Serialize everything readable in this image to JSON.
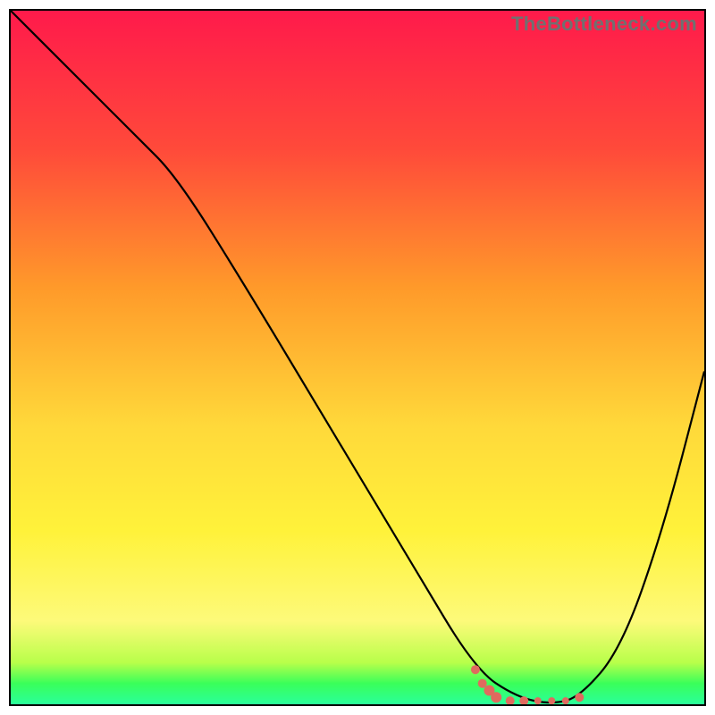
{
  "watermark": "TheBottleneck.com",
  "chart_data": {
    "type": "line",
    "title": "",
    "xlabel": "",
    "ylabel": "",
    "xlim": [
      0,
      100
    ],
    "ylim": [
      0,
      100
    ],
    "gradient_stops": [
      {
        "offset": 0,
        "color": "#ff1a4b"
      },
      {
        "offset": 20,
        "color": "#ff4a3a"
      },
      {
        "offset": 40,
        "color": "#ff9a2a"
      },
      {
        "offset": 60,
        "color": "#ffd93a"
      },
      {
        "offset": 75,
        "color": "#fff23a"
      },
      {
        "offset": 88,
        "color": "#fdfa7a"
      },
      {
        "offset": 94,
        "color": "#b8ff4a"
      },
      {
        "offset": 97,
        "color": "#3aff5a"
      },
      {
        "offset": 100,
        "color": "#2aff9a"
      }
    ],
    "series": [
      {
        "name": "bottleneck-curve",
        "color": "#000000",
        "x": [
          0,
          8,
          18,
          24,
          34,
          46,
          58,
          67,
          73,
          78,
          82,
          88,
          94,
          100
        ],
        "y": [
          100,
          92,
          82,
          76,
          60,
          40,
          20,
          5,
          1,
          0,
          1,
          8,
          25,
          48
        ]
      }
    ],
    "markers": {
      "name": "optimal-range",
      "color": "#e06a5e",
      "points": [
        {
          "x": 67,
          "y": 5,
          "r": 5
        },
        {
          "x": 68,
          "y": 3,
          "r": 5
        },
        {
          "x": 69,
          "y": 2,
          "r": 6
        },
        {
          "x": 70,
          "y": 1,
          "r": 6
        },
        {
          "x": 72,
          "y": 0.5,
          "r": 5
        },
        {
          "x": 74,
          "y": 0.5,
          "r": 5
        },
        {
          "x": 76,
          "y": 0.5,
          "r": 4
        },
        {
          "x": 78,
          "y": 0.5,
          "r": 4
        },
        {
          "x": 80,
          "y": 0.5,
          "r": 4
        },
        {
          "x": 82,
          "y": 1,
          "r": 5
        }
      ]
    }
  }
}
